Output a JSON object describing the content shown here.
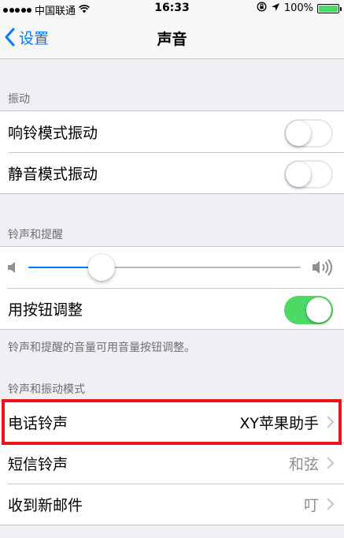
{
  "status_bar": {
    "carrier": "中国联通",
    "time": "16:33",
    "battery_text": "100%",
    "battery_level": 1.0
  },
  "nav": {
    "back_label": "设置",
    "title": "声音"
  },
  "sections": {
    "vibration": {
      "header": "振动",
      "rows": [
        {
          "label": "响铃模式振动",
          "toggle_on": false
        },
        {
          "label": "静音模式振动",
          "toggle_on": false
        }
      ]
    },
    "ringer": {
      "header": "铃声和提醒",
      "volume_level": 0.27,
      "button_adjust_label": "用按钮调整",
      "button_adjust_on": true,
      "footer": "铃声和提醒的音量可用音量按钮调整。"
    },
    "patterns": {
      "header": "铃声和振动模式",
      "rows": [
        {
          "label": "电话铃声",
          "value": "XY苹果助手"
        },
        {
          "label": "短信铃声",
          "value": "和弦"
        },
        {
          "label": "收到新邮件",
          "value": "叮"
        }
      ]
    }
  },
  "colors": {
    "accent": "#007aff",
    "toggle_on": "#4cd964",
    "highlight": "#e8141c",
    "background": "#efeff4"
  }
}
